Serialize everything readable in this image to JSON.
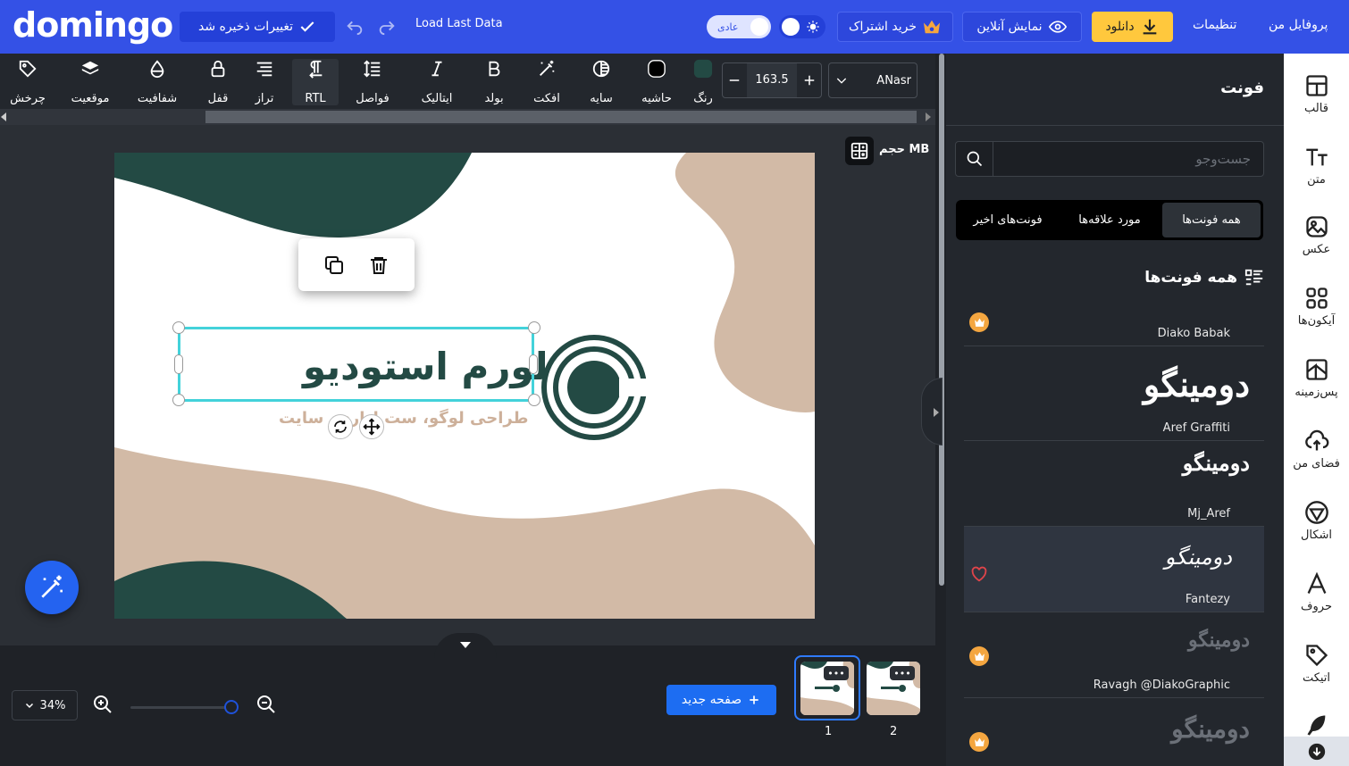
{
  "header": {
    "logo": "domingo",
    "save_label": "تغییرات ذخیره شد",
    "load_last": "Load Last Data",
    "mode_label": "عادی",
    "subscription_label": "خرید اشتراک",
    "preview_label": "نمایش آنلاین",
    "download_label": "دانلود",
    "settings_label": "تنظیمات",
    "profile_label": "پروفایل من"
  },
  "toolbar": {
    "tools": [
      {
        "label": "چرخش",
        "icon": "rotate-tag-icon"
      },
      {
        "label": "موقعیت",
        "icon": "layers-icon"
      },
      {
        "label": "شفافیت",
        "icon": "opacity-drop-icon"
      },
      {
        "label": "قفل",
        "icon": "lock-icon"
      },
      {
        "label": "تراز",
        "icon": "align-icon"
      },
      {
        "label": "RTL",
        "icon": "rtl-pilcrow-icon"
      },
      {
        "label": "فواصل",
        "icon": "line-spacing-icon"
      },
      {
        "label": "ایتالیک",
        "icon": "italic-icon"
      },
      {
        "label": "بولد",
        "icon": "bold-icon"
      },
      {
        "label": "افکت",
        "icon": "magic-wand-icon"
      },
      {
        "label": "سایه",
        "icon": "shadow-icon"
      },
      {
        "label": "حاشیه",
        "icon": "stroke-icon"
      },
      {
        "label": "رنگ",
        "icon": "color-swatch-icon"
      }
    ],
    "font_size": "163.5",
    "font_family": "ANasr"
  },
  "canvas": {
    "size_label": "حجم MB",
    "main_text": "لورم استودیو",
    "sub_text": "طراحی لوگو، ست اداری، سایت"
  },
  "fonts_panel": {
    "title": "فونت",
    "search_placeholder": "جست‌وجو",
    "tabs": [
      "همه فونت‌ها",
      "مورد علاقه‌ها",
      "فونت‌های اخیر"
    ],
    "list_title": "همه فونت‌ها",
    "fonts": [
      {
        "name": "Diako Babak",
        "sample": "",
        "premium": true
      },
      {
        "name": "Aref Graffiti",
        "sample": "دومینگو",
        "premium": false
      },
      {
        "name": "Mj_Aref",
        "sample": "دومینگو",
        "premium": false
      },
      {
        "name": "Fantezy",
        "sample": "دومینگو",
        "premium": false,
        "favorite_icon": "heart-icon"
      },
      {
        "name": "Ravagh @DiakoGraphic",
        "sample": "دومینگو",
        "premium": true
      },
      {
        "name": "",
        "sample": "دومینگو",
        "premium": true
      }
    ]
  },
  "sidebar": {
    "items": [
      {
        "label": "قالب",
        "icon": "template-icon"
      },
      {
        "label": "متن",
        "icon": "text-icon"
      },
      {
        "label": "عکس",
        "icon": "image-icon"
      },
      {
        "label": "آیکون‌ها",
        "icon": "icons-grid-icon"
      },
      {
        "label": "پس‌زمینه",
        "icon": "background-icon"
      },
      {
        "label": "فضای من",
        "icon": "cloud-upload-icon"
      },
      {
        "label": "اشکال",
        "icon": "shapes-icon"
      },
      {
        "label": "حروف",
        "icon": "letters-icon"
      },
      {
        "label": "اتیکت",
        "icon": "tag-icon"
      }
    ]
  },
  "bottom": {
    "zoom": "34%",
    "new_page_label": "صفحه جدید",
    "pages": [
      "1",
      "2"
    ]
  },
  "colors": {
    "topbar": "#3451e6",
    "accent_yellow": "#ffc83d",
    "design_dark": "#234a44",
    "design_beige": "#cdb09a",
    "selection": "#43d2da"
  }
}
